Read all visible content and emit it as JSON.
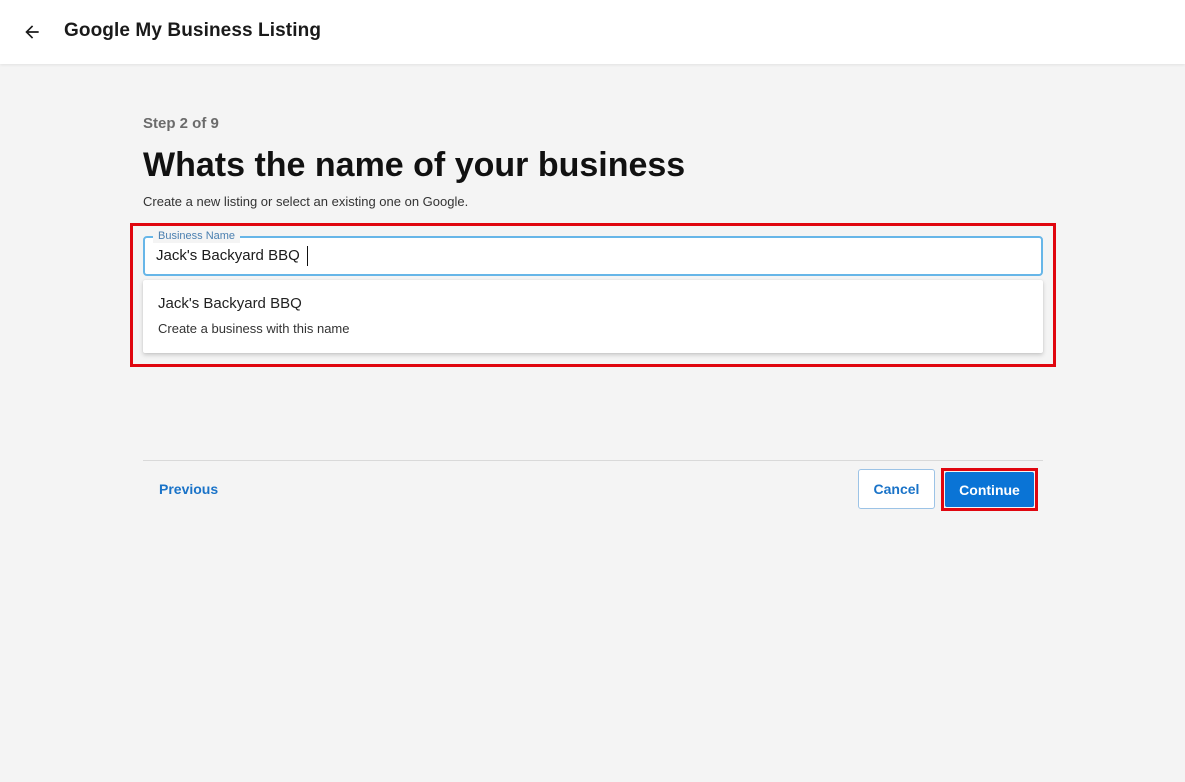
{
  "header": {
    "back_icon": "arrow-left-icon",
    "title": "Google My Business Listing"
  },
  "wizard": {
    "step": "Step 2 of 9",
    "heading": "Whats the name of your business",
    "subtitle": "Create a new listing or select an existing one on Google."
  },
  "business_name_field": {
    "label": "Business Name",
    "value": "Jack's Backyard BBQ"
  },
  "suggestion": {
    "title": "Jack's Backyard BBQ",
    "subtitle": "Create a business with this name"
  },
  "footer": {
    "previous_label": "Previous",
    "cancel_label": "Cancel",
    "continue_label": "Continue"
  },
  "colors": {
    "accent": "#0a74d6",
    "link": "#1a73c8",
    "highlight": "#e0060f",
    "background": "#f4f4f4"
  }
}
